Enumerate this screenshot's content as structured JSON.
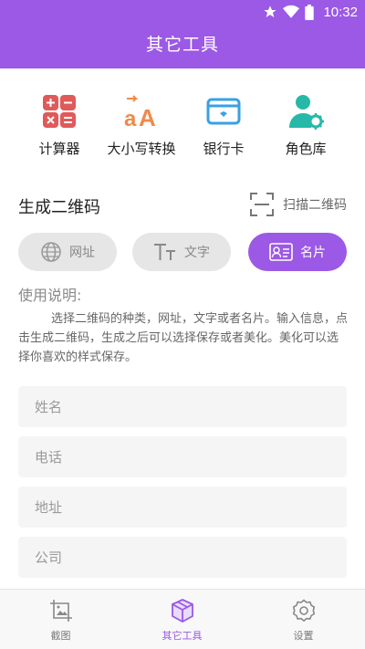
{
  "status_bar": {
    "time": "10:32",
    "icons": [
      "star-icon",
      "wifi-icon",
      "battery-icon"
    ]
  },
  "header": {
    "title": "其它工具"
  },
  "tools": [
    {
      "label": "计算器",
      "icon": "calculator-icon"
    },
    {
      "label": "大小写转换",
      "icon": "case-convert-icon"
    },
    {
      "label": "银行卡",
      "icon": "bank-card-icon"
    },
    {
      "label": "角色库",
      "icon": "role-library-icon"
    }
  ],
  "qr": {
    "title": "生成二维码",
    "scan_label": "扫描二维码",
    "tabs": [
      {
        "label": "网址",
        "icon": "globe-icon",
        "active": false
      },
      {
        "label": "文字",
        "icon": "text-icon",
        "active": false
      },
      {
        "label": "名片",
        "icon": "card-icon",
        "active": true
      }
    ]
  },
  "usage": {
    "title": "使用说明:",
    "body": "选择二维码的种类，网址，文字或者名片。输入信息，点击生成二维码，生成之后可以选择保存或者美化。美化可以选择你喜欢的样式保存。"
  },
  "form": {
    "name_placeholder": "姓名",
    "phone_placeholder": "电话",
    "address_placeholder": "地址",
    "company_placeholder": "公司"
  },
  "bottom_nav": [
    {
      "label": "截图",
      "icon": "screenshot-icon",
      "active": false
    },
    {
      "label": "其它工具",
      "icon": "tools-box-icon",
      "active": true
    },
    {
      "label": "设置",
      "icon": "settings-icon",
      "active": false
    }
  ],
  "colors": {
    "accent": "#9b59e6",
    "calculator": "#e05a5a",
    "case": "#f08a4b",
    "bank": "#3aa0e6",
    "role": "#27b8a8"
  }
}
